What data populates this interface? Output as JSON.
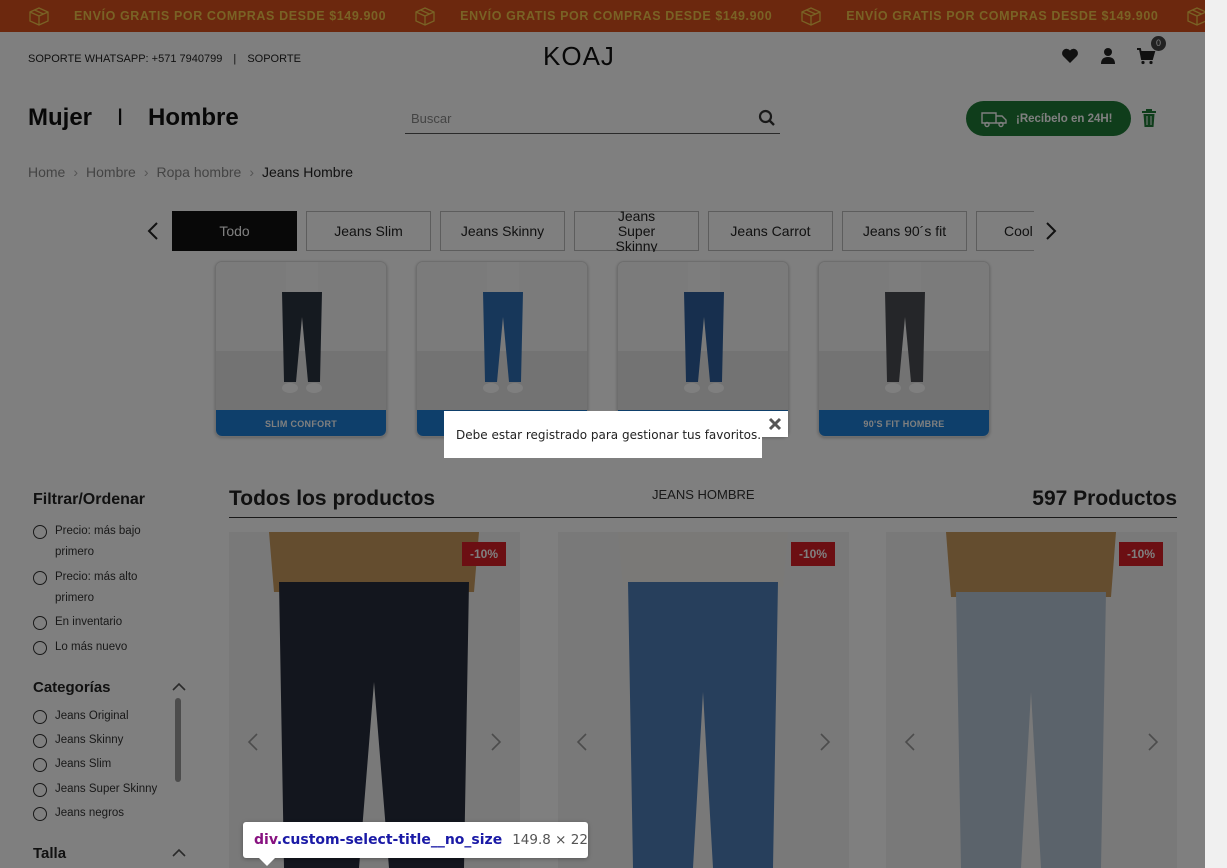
{
  "promo": {
    "text": "ENVÍO GRATIS POR COMPRAS DESDE $149.900",
    "colors": {
      "bg": "#d9501c",
      "text": "#f3c54a"
    }
  },
  "header": {
    "support_whatsapp": "SOPORTE WHATSAPP: +571 7940799",
    "support_sep": "|",
    "support_link": "SOPORTE",
    "logo": "KOAJ",
    "cart_count": "0",
    "icons": [
      "heart-icon",
      "user-icon",
      "cart-icon"
    ]
  },
  "nav": {
    "women": "Mujer",
    "sep": "I",
    "men": "Hombre",
    "search_placeholder": "Buscar",
    "delivery_button": "¡Recíbelo en 24H!",
    "delivery_color": "#1f7a36"
  },
  "breadcrumb": {
    "items": [
      "Home",
      "Hombre",
      "Ropa hombre"
    ],
    "current": "Jeans Hombre",
    "sep": "›"
  },
  "tabs": [
    "Todo",
    "Jeans Slim",
    "Jeans Skinny",
    "Jeans Super Skinny",
    "Jeans Carrot",
    "Jeans 90´s fit",
    "Cool"
  ],
  "featured": [
    {
      "label": "SLIM CONFORT"
    },
    {
      "label": ""
    },
    {
      "label": ""
    },
    {
      "label": "90'S FIT HOMBRE"
    }
  ],
  "filters": {
    "title": "Filtrar/Ordenar",
    "sort_options": [
      "Precio: más bajo primero",
      "Precio: más alto primero",
      "En inventario",
      "Lo más nuevo"
    ],
    "categories_title": "Categorías",
    "categories": [
      "Jeans Original",
      "Jeans Skinny",
      "Jeans Slim",
      "Jeans Super Skinny",
      "Jeans negros"
    ],
    "size_title": "Talla"
  },
  "products": {
    "title": "Todos los productos",
    "subtitle": "JEANS HOMBRE",
    "count": "597 Productos",
    "items": [
      {
        "discount": "-10%"
      },
      {
        "discount": "-10%"
      },
      {
        "discount": "-10%"
      }
    ]
  },
  "alert": {
    "message": "Debe estar registrado para gestionar tus favoritos."
  },
  "devtools_tooltip": {
    "tag": "div",
    "class_name": ".custom-select-title__no_size",
    "dimensions": "149.8 × 22"
  }
}
